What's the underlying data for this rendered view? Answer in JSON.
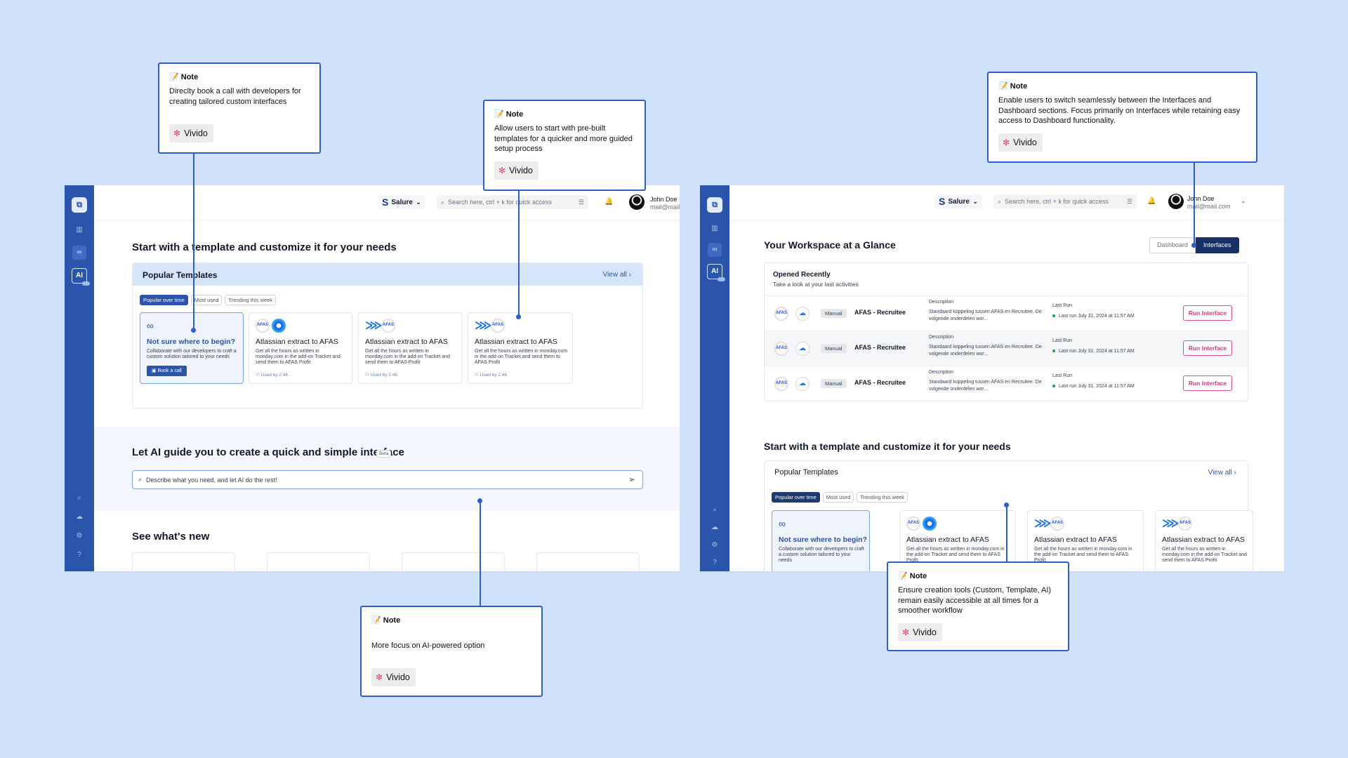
{
  "left_screen": {
    "workspace": "Salure",
    "search_placeholder": "Search here, ctrl + k for quick access",
    "user": {
      "name": "John Doe",
      "email": "mail@mail.com"
    },
    "section_title": "Start with a template and customize it for your needs",
    "templates": {
      "title": "Popular Templates",
      "view_all": "View all",
      "tabs": [
        "Popular over time",
        "Most used",
        "Trending this week"
      ],
      "cards": [
        {
          "title": "Not sure where to begin?",
          "description": "Collaborate with our developers to craft a custom solution tailored to your needs",
          "button": "Book a call"
        },
        {
          "title": "Atlassian extract to AFAS",
          "description": "Get all the hours as written in monday.com in the add-on Tracket and send them to AFAS Profit",
          "used": "Used by 2.4K"
        },
        {
          "title": "Atlassian extract to AFAS",
          "description": "Get all the hours as written in monday.com in the add-on Tracket and send them to AFAS Profit",
          "used": "Used by 2.4K"
        },
        {
          "title": "Atlassian extract to AFAS",
          "description": "Get all the hours as written in monday.com in the add-on Tracket and send them to AFAS Profit",
          "used": "Used by 2.4K"
        }
      ]
    },
    "ai": {
      "title": "Let AI guide you to create a quick and simple interface",
      "badge": "Beta",
      "placeholder": "Describe what you need, and let AI do the rest!"
    },
    "news_title": "See what's new"
  },
  "right_screen": {
    "workspace": "Salure",
    "search_placeholder": "Search here, ctrl + k for quick access",
    "user": {
      "name": "John Doe",
      "email": "mail@mail.com"
    },
    "title": "Your Workspace at a Glance",
    "toggle": {
      "dashboard": "Dashboard",
      "interfaces": "Interfaces"
    },
    "recent": {
      "title": "Opened Recently",
      "subtitle": "Take a look at your last activities",
      "rows": [
        {
          "type": "Manual",
          "name": "AFAS - Recruitee",
          "description_label": "Description",
          "description": "Standaard koppeling tussen AFAS en Recruitee. De volgende onderdelen wor...",
          "last_run_label": "Last Run",
          "last_run": "Last run July 31, 2024 at 11:57 AM",
          "action": "Run Interface"
        },
        {
          "type": "Manual",
          "name": "AFAS - Recruitee",
          "description_label": "Description",
          "description": "Standaard koppeling tussen AFAS en Recruitee. De volgende onderdelen wor...",
          "last_run_label": "Last Run",
          "last_run": "Last run July 31, 2024 at 11:57 AM",
          "action": "Run Interface"
        },
        {
          "type": "Manual",
          "name": "AFAS - Recruitee",
          "description_label": "Description",
          "description": "Standaard koppeling tussen AFAS en Recruitee. De volgende onderdelen wor...",
          "last_run_label": "Last Run",
          "last_run": "Last run July 31, 2024 at 11:57 AM",
          "action": "Run Interface"
        }
      ]
    },
    "section_title": "Start with a template and customize it for your needs",
    "templates": {
      "title": "Popular Templates",
      "view_all": "View all",
      "tabs": [
        "Popular over time",
        "Most used",
        "Trending this week"
      ],
      "cards": [
        {
          "title": "Not sure where to begin?",
          "description": "Collaborate with our developers to craft a custom solution tailored to your needs"
        },
        {
          "title": "Atlassian extract to AFAS",
          "description": "Get all the hours as written in monday.com in the add-on Tracket and send them to AFAS Profit"
        },
        {
          "title": "Atlassian extract to AFAS",
          "description": "Get all the hours as written in monday.com in the add-on Tracket and send them to AFAS Profit"
        },
        {
          "title": "Atlassian extract to AFAS",
          "description": "Get all the hours as written in monday.com in the add-on Tracket and send them to AFAS Profit"
        }
      ]
    }
  },
  "notes": [
    {
      "heading": "Note",
      "body": "Direclty book a call with developers for creating tailored custom interfaces",
      "chip": "Vivido"
    },
    {
      "heading": "Note",
      "body": "Allow users to start with pre-built templates for a quicker and more guided setup process",
      "chip": "Vivido"
    },
    {
      "heading": "Note",
      "body": "More focus on AI-powered option",
      "chip": "Vivido"
    },
    {
      "heading": "Note",
      "body": "Enable users to switch seamlessly between the Interfaces and Dashboard sections. Focus primarily on Interfaces while retaining easy access to Dashboard functionality.",
      "chip": "Vivido"
    },
    {
      "heading": "Note",
      "body": "Ensure creation tools (Custom, Template, AI) remain easily accessible at all times for a smoother workflow",
      "chip": "Vivido"
    }
  ],
  "icons": {
    "afas": "AFAS",
    "ai": "AI"
  },
  "colors": {
    "canvas": "#d0e1fb",
    "sidebar": "#2a55aa",
    "note_border": "#2c5fca",
    "run_button": "#d43a80",
    "toggle_active": "#173066"
  }
}
